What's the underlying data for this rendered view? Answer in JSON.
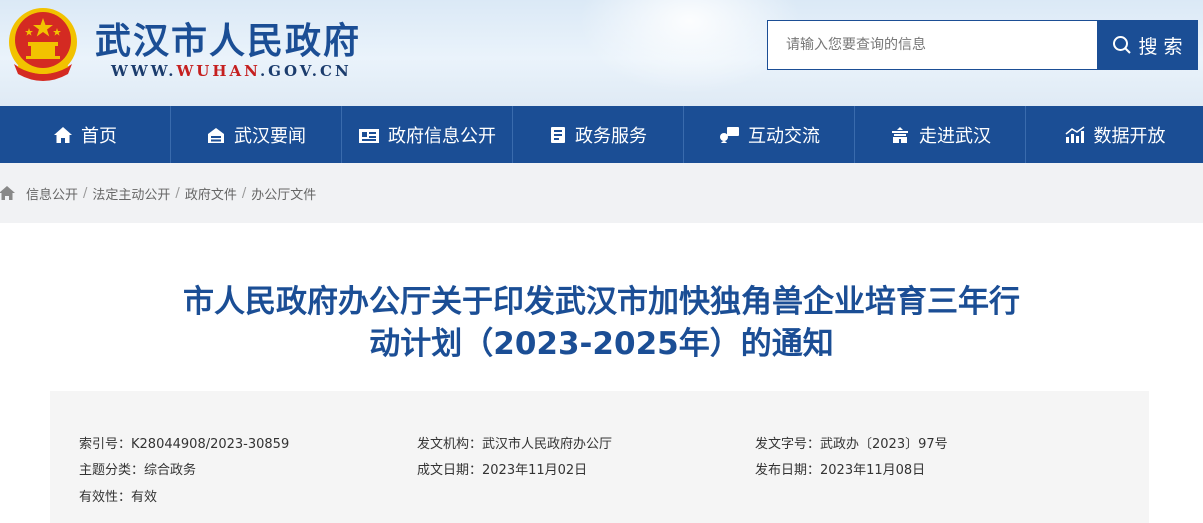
{
  "site": {
    "title": "武汉市人民政府",
    "url_prefix": "WWW.",
    "url_highlight": "WUHAN",
    "url_suffix": ".GOV.CN"
  },
  "search": {
    "placeholder": "请输入您要查询的信息",
    "button_label": "搜 索"
  },
  "nav": {
    "items": [
      {
        "label": "首页",
        "icon": "home-icon"
      },
      {
        "label": "武汉要闻",
        "icon": "news-icon"
      },
      {
        "label": "政府信息公开",
        "icon": "info-icon"
      },
      {
        "label": "政务服务",
        "icon": "service-icon"
      },
      {
        "label": "互动交流",
        "icon": "chat-icon"
      },
      {
        "label": "走进武汉",
        "icon": "building-icon"
      },
      {
        "label": "数据开放",
        "icon": "chart-icon"
      }
    ]
  },
  "breadcrumb": {
    "items": [
      "信息公开",
      "法定主动公开",
      "政府文件",
      "办公厅文件"
    ],
    "separator": "/"
  },
  "document": {
    "title_line1": "市人民政府办公厅关于印发武汉市加快独角兽企业培育三年行",
    "title_line2": "动计划（2023-2025年）的通知",
    "meta": {
      "index_label": "索引号：",
      "index_value": "K28044908/2023-30859",
      "issuer_label": "发文机构：",
      "issuer_value": "武汉市人民政府办公厅",
      "docno_label": "发文字号：",
      "docno_value": "武政办〔2023〕97号",
      "topic_label": "主题分类：",
      "topic_value": "综合政务",
      "created_label": "成文日期：",
      "created_value": "2023年11月02日",
      "published_label": "发布日期：",
      "published_value": "2023年11月08日",
      "validity_label": "有效性：",
      "validity_value": "有效"
    }
  },
  "colors": {
    "brand": "#1b4e95",
    "url_highlight": "#c51f1f",
    "emblem_red": "#d42a22",
    "emblem_gold": "#f2c200"
  }
}
